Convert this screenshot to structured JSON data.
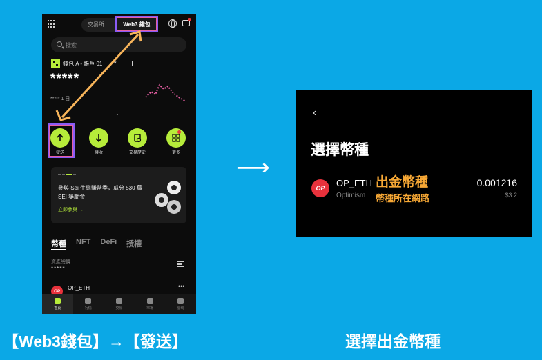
{
  "phone": {
    "tabs": {
      "exchange": "交易所",
      "web3": "Web3 錢包"
    },
    "search_placeholder": "搜索",
    "wallet_name": "錢包 A - 賬戶 01",
    "balance_masked": "*****",
    "period": "***** 1 日",
    "actions": [
      {
        "label": "發送",
        "icon": "arrow-up-icon"
      },
      {
        "label": "接收",
        "icon": "arrow-down-icon"
      },
      {
        "label": "交易歷史",
        "icon": "history-icon"
      },
      {
        "label": "更多",
        "icon": "more-icon"
      }
    ],
    "promo": {
      "text": "參與 Sei 生態賺幣季，瓜分 530 萬 SEI 獎勵金",
      "link": "立即參與 →"
    },
    "asset_tabs": [
      "幣種",
      "NFT",
      "DeFi",
      "授權"
    ],
    "asset_value_label": "資產總價",
    "asset_value": "*****",
    "first_token": "OP_ETH",
    "bottom_nav": [
      "首頁",
      "行情",
      "交易",
      "市場",
      "發現"
    ]
  },
  "panel": {
    "title": "選擇幣種",
    "coin_name": "OP_ETH",
    "coin_network": "Optimism",
    "coin_logo_text": "OP",
    "amount": "0.001216",
    "fiat": "$3.2",
    "annotation_coin": "出金幣種",
    "annotation_network": "幣種所在網路"
  },
  "captions": {
    "left": "【Web3錢包】→【發送】",
    "right": "選擇出金幣種"
  },
  "colors": {
    "background": "#0ba8e6",
    "accent_green": "#b6ec3a",
    "highlight_pink": "#e65fa3",
    "highlight_purple": "#8a5cf6",
    "annotation_orange": "#f7a835",
    "op_red": "#e8323c"
  }
}
